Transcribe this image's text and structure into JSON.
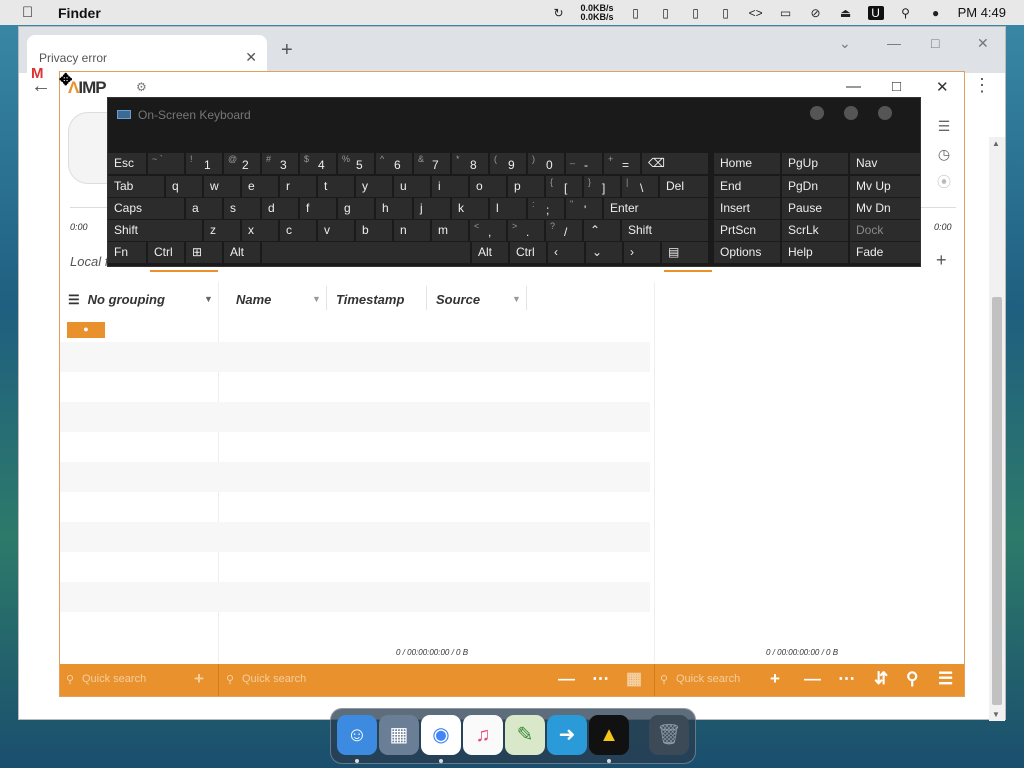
{
  "menubar": {
    "app_name": "Finder",
    "net_up": "0.0KB/s",
    "net_down": "0.0KB/s",
    "clock": "PM 4:49"
  },
  "browser": {
    "tab_title": "Privacy error"
  },
  "aimp": {
    "logo": "IMP",
    "time_left": "0:00",
    "time_right": "0:00",
    "local_files": "Local f",
    "grouping": "No grouping",
    "columns": [
      "Name",
      "Timestamp",
      "Source"
    ],
    "summary_left": "0 / 00:00:00:00 / 0 B",
    "summary_right": "0 / 00:00:00:00 / 0 B",
    "quick_search_1": "Quick search",
    "quick_search_2": "Quick search",
    "quick_search_3": "Quick search"
  },
  "osk": {
    "title": "On-Screen Keyboard",
    "rows": {
      "r1": [
        "Esc",
        "1",
        "2",
        "3",
        "4",
        "5",
        "6",
        "7",
        "8",
        "9",
        "0",
        "-",
        "="
      ],
      "r1_sub": [
        "~ `",
        "!",
        "@",
        "#",
        "$",
        "%",
        "^",
        "&",
        "*",
        "(",
        ")",
        "_",
        "+"
      ],
      "r2": [
        "Tab",
        "q",
        "w",
        "e",
        "r",
        "t",
        "y",
        "u",
        "i",
        "o",
        "p",
        "[",
        "]",
        "\\",
        "Del"
      ],
      "r2_sub": [
        "{",
        "}",
        "|"
      ],
      "r3": [
        "Caps",
        "a",
        "s",
        "d",
        "f",
        "g",
        "h",
        "j",
        "k",
        "l",
        ";",
        "'",
        "Enter"
      ],
      "r3_sub": [
        ":",
        "\""
      ],
      "r4": [
        "Shift",
        "z",
        "x",
        "c",
        "v",
        "b",
        "n",
        "m",
        ",",
        ".",
        "/",
        "Shift"
      ],
      "r4_sub": [
        "<",
        ">",
        "?"
      ],
      "r5": [
        "Fn",
        "Ctrl",
        "Alt",
        "Alt",
        "Ctrl"
      ]
    },
    "nav": [
      [
        "Home",
        "PgUp",
        "Nav"
      ],
      [
        "End",
        "PgDn",
        "Mv Up"
      ],
      [
        "Insert",
        "Pause",
        "Mv Dn"
      ],
      [
        "PrtScn",
        "ScrLk",
        "Dock"
      ],
      [
        "Options",
        "Help",
        "Fade"
      ]
    ]
  }
}
